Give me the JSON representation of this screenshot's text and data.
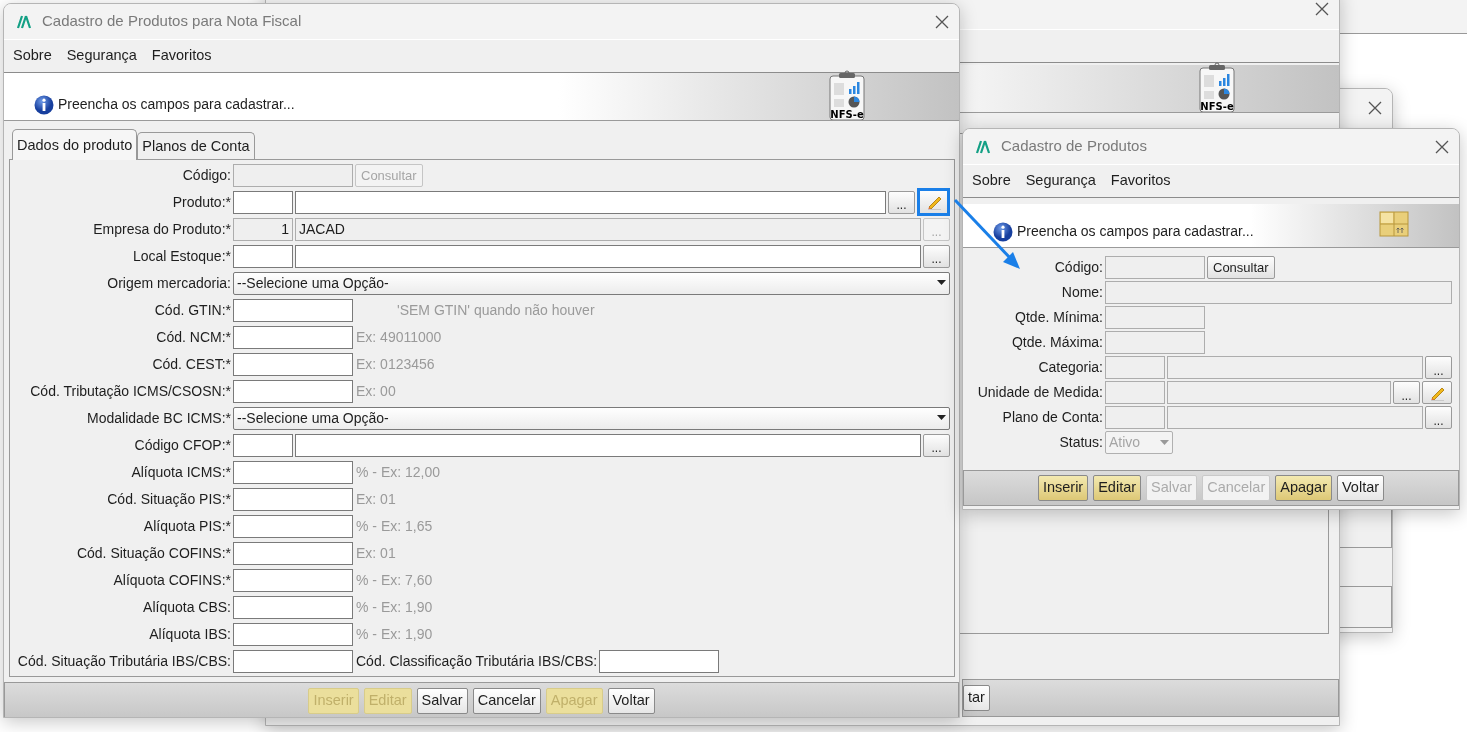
{
  "background_windows": [
    {
      "kind": "plain"
    },
    {
      "kind": "report",
      "header_icon": {
        "kind": "report",
        "caption": "NFS-e"
      },
      "buttons": [
        {
          "label": "tar"
        }
      ]
    }
  ],
  "main_window": {
    "title": "Cadastro de Produtos para Nota Fiscal",
    "menu": [
      {
        "label": "Sobre"
      },
      {
        "label": "Segurança"
      },
      {
        "label": "Favoritos"
      }
    ],
    "message": "Preencha os campos para cadastrar...",
    "header_icon": {
      "kind": "report",
      "caption": "NFS-e"
    },
    "tabs": [
      {
        "label": "Dados do produto",
        "selected": true
      },
      {
        "label": "Planos de Conta",
        "selected": false
      }
    ],
    "rows": [
      {
        "label": "Código:",
        "parts": [
          {
            "kind": "field",
            "disabled": true
          },
          {
            "kind": "button",
            "label": "Consultar",
            "disabled": true
          }
        ]
      },
      {
        "label": "Produto:*",
        "parts": [
          {
            "kind": "code",
            "disabled": false
          },
          {
            "kind": "name",
            "disabled": false
          },
          {
            "kind": "ellipsis",
            "label": "...",
            "disabled": false
          },
          {
            "kind": "edit",
            "disabled": false,
            "highlighted": true
          }
        ]
      },
      {
        "label": "Empresa do Produto:*",
        "parts": [
          {
            "kind": "code",
            "value": "1",
            "disabled": true
          },
          {
            "kind": "name",
            "value": "JACAD",
            "disabled": true
          },
          {
            "kind": "ellipsis",
            "label": "...",
            "disabled": true
          }
        ]
      },
      {
        "label": "Local Estoque:*",
        "parts": [
          {
            "kind": "code",
            "disabled": false
          },
          {
            "kind": "name",
            "disabled": false
          },
          {
            "kind": "ellipsis",
            "label": "...",
            "disabled": false
          }
        ]
      },
      {
        "label": "Origem mercadoria:",
        "parts": [
          {
            "kind": "select",
            "value": "--Selecione uma Opção-",
            "disabled": false
          }
        ]
      },
      {
        "label": "Cód. GTIN:*",
        "parts": [
          {
            "kind": "field",
            "disabled": false
          },
          {
            "kind": "hint",
            "text": "'SEM GTIN' quando não houver"
          }
        ]
      },
      {
        "label": "Cód. NCM:*",
        "parts": [
          {
            "kind": "field",
            "disabled": false
          },
          {
            "kind": "hint",
            "text": "Ex: 49011000"
          }
        ]
      },
      {
        "label": "Cód. CEST:*",
        "parts": [
          {
            "kind": "field",
            "disabled": false
          },
          {
            "kind": "hint",
            "text": "Ex: 0123456"
          }
        ]
      },
      {
        "label": "Cód. Tributação ICMS/CSOSN:*",
        "parts": [
          {
            "kind": "field",
            "disabled": false
          },
          {
            "kind": "hint",
            "text": "Ex: 00"
          }
        ]
      },
      {
        "label": "Modalidade BC ICMS:*",
        "parts": [
          {
            "kind": "select",
            "value": "--Selecione uma Opção-",
            "disabled": false
          }
        ]
      },
      {
        "label": "Código CFOP:*",
        "parts": [
          {
            "kind": "code",
            "disabled": false
          },
          {
            "kind": "name",
            "disabled": false
          },
          {
            "kind": "ellipsis",
            "label": "...",
            "disabled": false
          }
        ]
      },
      {
        "label": "Alíquota ICMS:*",
        "parts": [
          {
            "kind": "field",
            "disabled": false
          },
          {
            "kind": "hint",
            "text": "% - Ex: 12,00"
          }
        ]
      },
      {
        "label": "Cód. Situação PIS:*",
        "parts": [
          {
            "kind": "field",
            "disabled": false
          },
          {
            "kind": "hint",
            "text": "Ex: 01"
          }
        ]
      },
      {
        "label": "Alíquota PIS:*",
        "parts": [
          {
            "kind": "field",
            "disabled": false
          },
          {
            "kind": "hint",
            "text": "% - Ex: 1,65"
          }
        ]
      },
      {
        "label": "Cód. Situação COFINS:*",
        "parts": [
          {
            "kind": "field",
            "disabled": false
          },
          {
            "kind": "hint",
            "text": "Ex: 01"
          }
        ]
      },
      {
        "label": "Alíquota COFINS:*",
        "parts": [
          {
            "kind": "field",
            "disabled": false
          },
          {
            "kind": "hint",
            "text": "% - Ex: 7,60"
          }
        ]
      },
      {
        "label": "Alíquota CBS:",
        "parts": [
          {
            "kind": "field",
            "disabled": false
          },
          {
            "kind": "hint",
            "text": "% - Ex: 1,90"
          }
        ]
      },
      {
        "label": "Alíquota IBS:",
        "parts": [
          {
            "kind": "field",
            "disabled": false
          },
          {
            "kind": "hint",
            "text": "% - Ex: 1,90"
          }
        ]
      },
      {
        "label": "Cód. Situação Tributária IBS/CBS:",
        "parts": [
          {
            "kind": "field",
            "disabled": false
          },
          {
            "kind": "caption",
            "text": "Cód. Classificação Tributária IBS/CBS:"
          },
          {
            "kind": "field",
            "disabled": false
          }
        ]
      }
    ],
    "buttons": [
      {
        "label": "Inserir",
        "accent": true,
        "disabled": true
      },
      {
        "label": "Editar",
        "accent": true,
        "disabled": true
      },
      {
        "label": "Salvar",
        "accent": false,
        "disabled": false
      },
      {
        "label": "Cancelar",
        "accent": false,
        "disabled": false
      },
      {
        "label": "Apagar",
        "accent": true,
        "disabled": true
      },
      {
        "label": "Voltar",
        "accent": false,
        "disabled": false
      }
    ]
  },
  "product_window": {
    "title": "Cadastro de Produtos",
    "menu": [
      {
        "label": "Sobre"
      },
      {
        "label": "Segurança"
      },
      {
        "label": "Favoritos"
      }
    ],
    "message": "Preencha os campos para cadastrar...",
    "header_icon": {
      "kind": "boxes"
    },
    "rows": [
      {
        "label": "Código:",
        "parts": [
          {
            "kind": "field",
            "disabled": true
          },
          {
            "kind": "button",
            "label": "Consultar",
            "disabled": false
          }
        ]
      },
      {
        "label": "Nome:",
        "parts": [
          {
            "kind": "name",
            "disabled": true
          }
        ]
      },
      {
        "label": "Qtde. Mínima:",
        "parts": [
          {
            "kind": "field",
            "disabled": true
          }
        ]
      },
      {
        "label": "Qtde. Máxima:",
        "parts": [
          {
            "kind": "field",
            "disabled": true
          }
        ]
      },
      {
        "label": "Categoria:",
        "parts": [
          {
            "kind": "code",
            "disabled": true
          },
          {
            "kind": "name",
            "disabled": true
          },
          {
            "kind": "ellipsis",
            "label": "...",
            "disabled": false
          }
        ]
      },
      {
        "label": "Unidade de Medida:",
        "parts": [
          {
            "kind": "code",
            "disabled": true
          },
          {
            "kind": "name",
            "disabled": true
          },
          {
            "kind": "ellipsis",
            "label": "...",
            "disabled": false
          },
          {
            "kind": "edit",
            "disabled": false,
            "highlighted": false
          }
        ]
      },
      {
        "label": "Plano de Conta:",
        "parts": [
          {
            "kind": "code",
            "disabled": true
          },
          {
            "kind": "name",
            "disabled": true
          },
          {
            "kind": "ellipsis",
            "label": "...",
            "disabled": false
          }
        ]
      },
      {
        "label": "Status:",
        "parts": [
          {
            "kind": "status",
            "value": "Ativo",
            "disabled": true
          }
        ]
      }
    ],
    "buttons": [
      {
        "label": "Inserir",
        "accent": true,
        "disabled": false
      },
      {
        "label": "Editar",
        "accent": true,
        "disabled": false
      },
      {
        "label": "Salvar",
        "accent": false,
        "disabled": true
      },
      {
        "label": "Cancelar",
        "accent": false,
        "disabled": true
      },
      {
        "label": "Apagar",
        "accent": true,
        "disabled": false
      },
      {
        "label": "Voltar",
        "accent": false,
        "disabled": false
      }
    ]
  },
  "annotation": {
    "kind": "arrow"
  }
}
